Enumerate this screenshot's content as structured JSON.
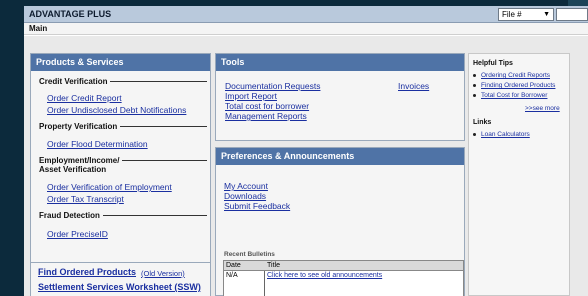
{
  "app": {
    "title": "ADVANTAGE PLUS"
  },
  "file_menu": {
    "selected": "File #"
  },
  "menu": {
    "main_label": "Main"
  },
  "products": {
    "heading": "Products & Services",
    "credit": {
      "title": "Credit Verification",
      "links": [
        "Order Credit Report",
        "Order Undisclosed Debt Notifications"
      ]
    },
    "property": {
      "title": "Property Verification",
      "links": [
        "Order Flood Determination"
      ]
    },
    "employment": {
      "title_line1": "Employment/Income/",
      "title_line2": "Asset Verification",
      "links": [
        "Order Verification of Employment",
        "Order Tax Transcript"
      ]
    },
    "fraud": {
      "title": "Fraud Detection",
      "links": [
        "Order PreciseID"
      ]
    },
    "footer": {
      "find_orders": "Find Ordered Products",
      "old_version": "(Old Version)",
      "settlement": "Settlement Services Worksheet (SSW)"
    }
  },
  "tools": {
    "heading": "Tools",
    "links": [
      "Documentation Requests",
      "Import Report",
      "Total cost for borrower",
      "Management Reports"
    ],
    "invoices": "Invoices"
  },
  "prefs": {
    "heading": "Preferences & Announcements",
    "links": [
      "My Account",
      "Downloads",
      "Submit Feedback"
    ],
    "bulletins_label": "Recent Bulletins",
    "columns": [
      "Date",
      "Title"
    ],
    "rows": [
      {
        "date": "N/A",
        "title": "Click here to see old announcements"
      }
    ]
  },
  "sidebar": {
    "tips_heading": "Helpful Tips",
    "tips": [
      "Ordering Credit Reports",
      "Finding Ordered Products",
      "Total Cost for Borrower"
    ],
    "see_more": ">>see more",
    "links_heading": "Links",
    "links": [
      "Loan Calculators"
    ]
  }
}
